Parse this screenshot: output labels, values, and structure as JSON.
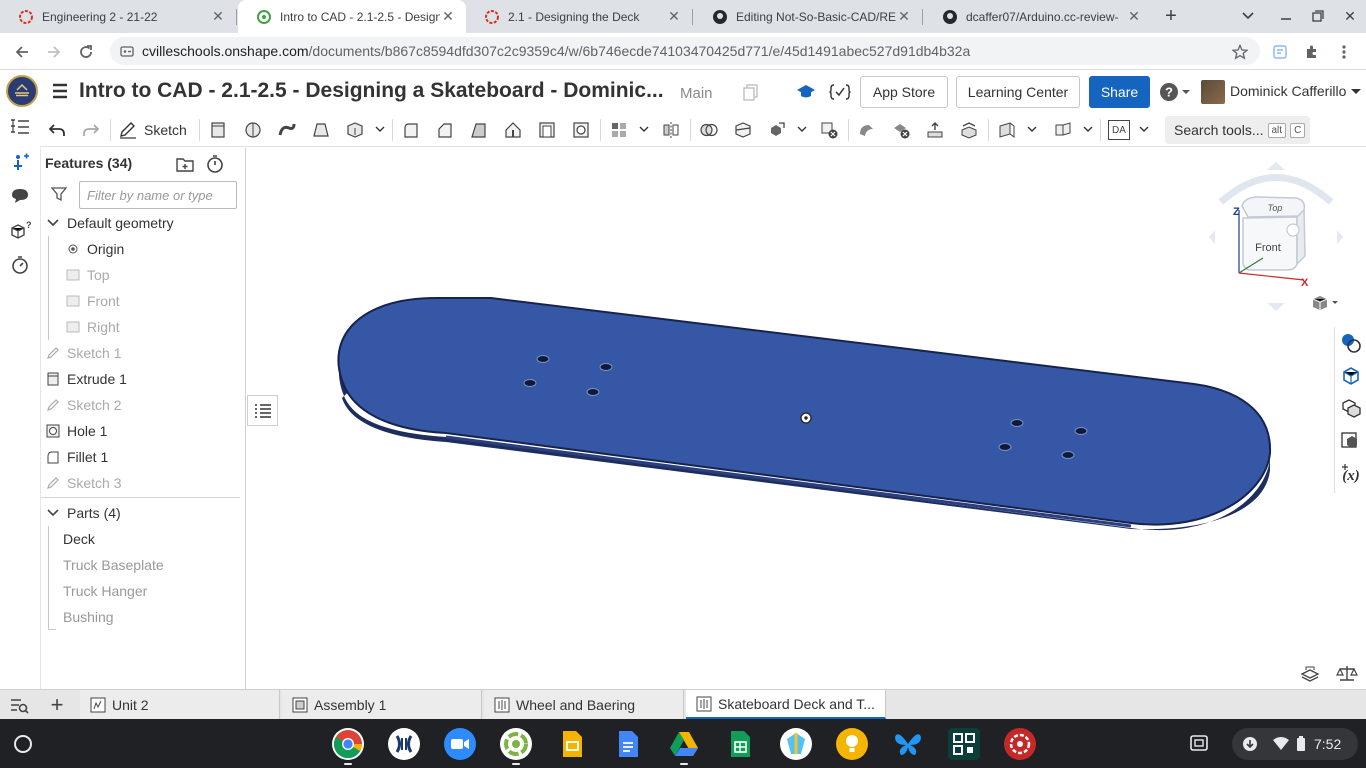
{
  "browser": {
    "tabs": [
      {
        "title": "Engineering 2 - 21-22",
        "icon": "onshape-red-icon"
      },
      {
        "title": "Intro to CAD - 2.1-2.5 - Designi",
        "icon": "onshape-green-icon"
      },
      {
        "title": "2.1 - Designing the Deck",
        "icon": "onshape-red-icon"
      },
      {
        "title": "Editing Not-So-Basic-CAD/REA",
        "icon": "github-icon"
      },
      {
        "title": "dcaffer07/Arduino.cc-review-",
        "icon": "github-icon"
      }
    ],
    "url_host": "cvilleschools.onshape.com",
    "url_path": "/documents/b867c8594dfd307c2c9359c4/w/6b746ecde74103470425d771/e/45d1491abec527d91db4b32a"
  },
  "header": {
    "title": "Intro to CAD - 2.1-2.5 - Designing a Skateboard - Dominic...",
    "branch": "Main",
    "app_store": "App Store",
    "learning_center": "Learning Center",
    "share": "Share",
    "user": "Dominick Cafferillo"
  },
  "toolbar": {
    "sketch_label": "Sketch",
    "da_label": "DA",
    "search_label": "Search tools...",
    "search_kbd_1": "alt",
    "search_kbd_2": "C"
  },
  "features": {
    "header": "Features (34)",
    "filter_placeholder": "Filter by name or type",
    "default_geometry": {
      "label": "Default geometry",
      "items": [
        "Origin",
        "Top",
        "Front",
        "Right"
      ]
    },
    "list": [
      "Sketch 1",
      "Extrude 1",
      "Sketch 2",
      "Hole 1",
      "Fillet 1",
      "Sketch 3"
    ],
    "parts": {
      "label": "Parts (4)",
      "items": [
        "Deck",
        "Truck Baseplate",
        "Truck Hanger",
        "Bushing"
      ]
    }
  },
  "viewcube": {
    "top": "Top",
    "front": "Front",
    "z": "Z",
    "x": "X"
  },
  "colors": {
    "deck": "#3557a5",
    "deck_edge": "#1d2d5c",
    "accent": "#1565c0"
  },
  "bottom_tabs": [
    {
      "label": "Unit 2",
      "icon": "partstudio-icon"
    },
    {
      "label": "Assembly 1",
      "icon": "assembly-icon"
    },
    {
      "label": "Wheel and Baering",
      "icon": "partstudio-icon"
    },
    {
      "label": "Skateboard Deck and T...",
      "icon": "partstudio-icon"
    }
  ],
  "shelf": {
    "apps": [
      "chrome-icon",
      "citrix-icon",
      "zoom-icon",
      "screencastify-icon",
      "slides-icon",
      "docs-icon",
      "drive-icon",
      "sheets-icon",
      "kami-icon",
      "keep-icon",
      "butterfly-icon",
      "qr-icon",
      "onshape-icon"
    ],
    "clock": "7:52"
  }
}
